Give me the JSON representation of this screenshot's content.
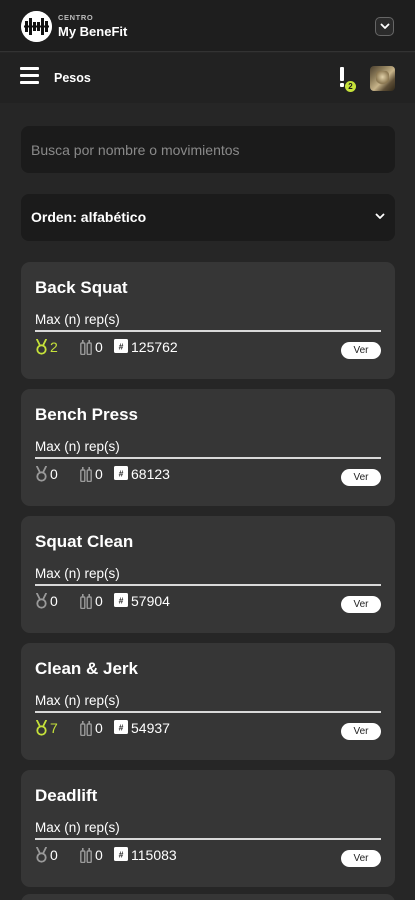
{
  "header": {
    "center_label": "CENTRO",
    "center_name": "My BeneFit",
    "logo_icon": "barbell-logo-icon",
    "toggle_icon": "chevron-down-icon"
  },
  "nav": {
    "menu_icon": "hamburger-menu-icon",
    "title": "Pesos",
    "alert_icon": "exclamation-icon",
    "alert_badge": "2",
    "avatar_icon": "user-avatar"
  },
  "search": {
    "value": "",
    "placeholder": "Busca por nombre o movimientos"
  },
  "sort": {
    "label": "Orden: alfabético"
  },
  "colors": {
    "background": "#262626",
    "card": "#363636",
    "accent": "#c6e23a"
  },
  "cards": [
    {
      "title": "Back Squat",
      "subtitle": "Max (n) rep(s)",
      "medals": "2",
      "bottles": "0",
      "ranking": "125762",
      "button": "Ver",
      "medals_highlight": true
    },
    {
      "title": "Bench Press",
      "subtitle": "Max (n) rep(s)",
      "medals": "0",
      "bottles": "0",
      "ranking": "68123",
      "button": "Ver",
      "medals_highlight": false
    },
    {
      "title": "Squat Clean",
      "subtitle": "Max (n) rep(s)",
      "medals": "0",
      "bottles": "0",
      "ranking": "57904",
      "button": "Ver",
      "medals_highlight": false
    },
    {
      "title": "Clean & Jerk",
      "subtitle": "Max (n) rep(s)",
      "medals": "7",
      "bottles": "0",
      "ranking": "54937",
      "button": "Ver",
      "medals_highlight": true
    },
    {
      "title": "Deadlift",
      "subtitle": "Max (n) rep(s)",
      "medals": "0",
      "bottles": "0",
      "ranking": "115083",
      "button": "Ver",
      "medals_highlight": false
    }
  ]
}
